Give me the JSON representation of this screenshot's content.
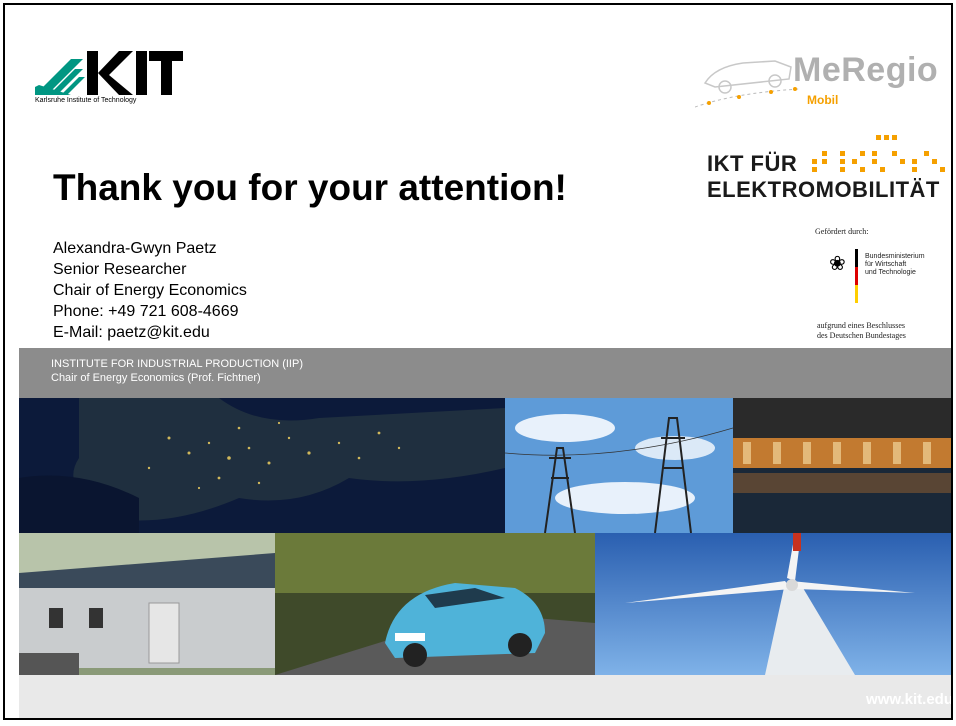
{
  "logos": {
    "kit_subtitle": "Karlsruhe Institute of Technology",
    "meregio_name": "MeRegio",
    "meregio_sub": "Mobil",
    "ikt_line1": "IKT FÜR",
    "ikt_line2": "ELEKTROMOBILITÄT",
    "funding_head": "Gefördert durch:",
    "ministry": "Bundesministerium\nfür Wirtschaft\nund Technologie",
    "funding_foot": "aufgrund eines Beschlusses\ndes Deutschen Bundestages"
  },
  "title": "Thank you for your attention!",
  "contact": {
    "name": "Alexandra-Gwyn Paetz",
    "position": "Senior Researcher",
    "chair": "Chair of Energy Economics",
    "phone": "Phone: +49 721 608-4669",
    "email": "E-Mail: paetz@kit.edu"
  },
  "institute": {
    "line1": "INSTITUTE FOR INDUSTRIAL PRODUCTION (IIP)",
    "line2": "Chair of Energy Economics (Prof. Fichtner)"
  },
  "footer_url": "www.kit.edu",
  "colors": {
    "kit_green": "#009682",
    "band_gray": "#8c8c8c",
    "meregio_orange": "#f5a000"
  }
}
